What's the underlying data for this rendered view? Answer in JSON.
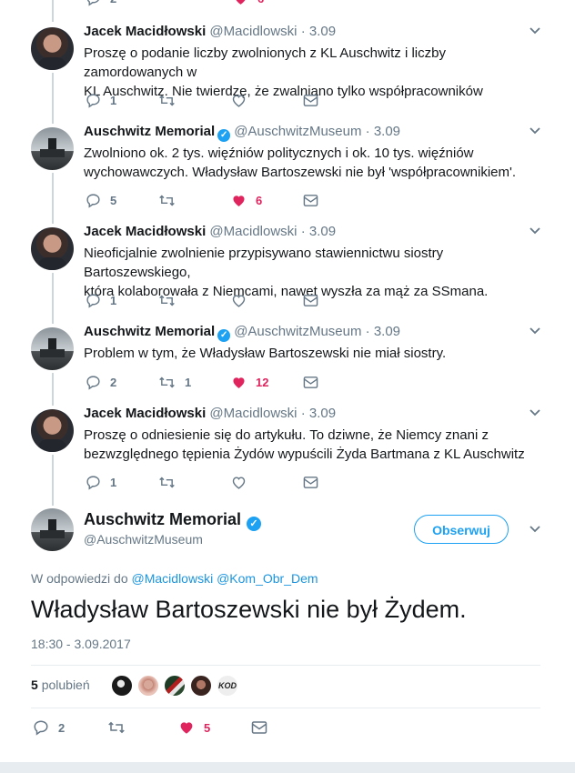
{
  "thread_tweets": [
    {
      "author": "Jacek Macidłowski",
      "handle": "@Macidlowski",
      "date": "3.09",
      "verified": false,
      "text": [
        "Proszę o podanie liczby zwolnionych z KL Auschwitz i liczby zamordowanych w",
        "KL Auschwitz. Nie twierdzę, że zwalniano tylko współpracowników"
      ],
      "replies": "1",
      "retweets": "",
      "likes": "",
      "liked": false
    },
    {
      "author": "Auschwitz Memorial",
      "handle": "@AuschwitzMuseum",
      "date": "3.09",
      "verified": true,
      "text": [
        "Zwolniono ok. 2 tys. więźniów politycznych i ok. 10 tys. więźniów",
        "wychowawczych. Władysław Bartoszewski nie był 'współpracownikiem'."
      ],
      "replies": "5",
      "retweets": "",
      "likes": "6",
      "liked": true
    },
    {
      "author": "Jacek Macidłowski",
      "handle": "@Macidlowski",
      "date": "3.09",
      "verified": false,
      "text": [
        "Nieoficjalnie zwolnienie przypisywano stawiennictwu siostry Bartoszewskiego,",
        "która kolaborowała z Niemcami, nawet wyszła za mąż za SSmana."
      ],
      "replies": "1",
      "retweets": "",
      "likes": "",
      "liked": false
    },
    {
      "author": "Auschwitz Memorial",
      "handle": "@AuschwitzMuseum",
      "date": "3.09",
      "verified": true,
      "text": [
        "Problem w tym, że Władysław Bartoszewski nie miał siostry."
      ],
      "replies": "2",
      "retweets": "1",
      "likes": "12",
      "liked": true
    },
    {
      "author": "Jacek Macidłowski",
      "handle": "@Macidlowski",
      "date": "3.09",
      "verified": false,
      "text": [
        "Proszę o odniesienie się do artykułu. To dziwne, że Niemcy znani z",
        "bezwzględnego tępienia Żydów wypuścili Żyda Bartmana z KL Auschwitz"
      ],
      "replies": "1",
      "retweets": "",
      "likes": "",
      "liked": false
    }
  ],
  "top_partial": {
    "replies": "2",
    "likes": "6"
  },
  "main_tweet": {
    "author": "Auschwitz Memorial",
    "handle": "@AuschwitzMuseum",
    "follow_label": "Obserwuj",
    "reply_prefix": "W odpowiedzi do",
    "reply_mention_1": "@Macidlowski",
    "reply_mention_2": "@Kom_Obr_Dem",
    "text": "Władysław Bartoszewski nie był Żydem.",
    "timestamp": "18:30 - 3.09.2017",
    "likes_count": "5",
    "likes_label": "polubień",
    "replies": "2",
    "retweets": "",
    "likes": "5",
    "liked": true
  },
  "liker_badge_text": "KOD",
  "colors": {
    "accent": "#1da1f2",
    "like": "#e0245e",
    "muted": "#657786",
    "text": "#14171a"
  },
  "icons": [
    "reply-icon",
    "retweet-icon",
    "heart-icon",
    "message-icon",
    "chevron-down-icon",
    "verified-badge-icon"
  ]
}
